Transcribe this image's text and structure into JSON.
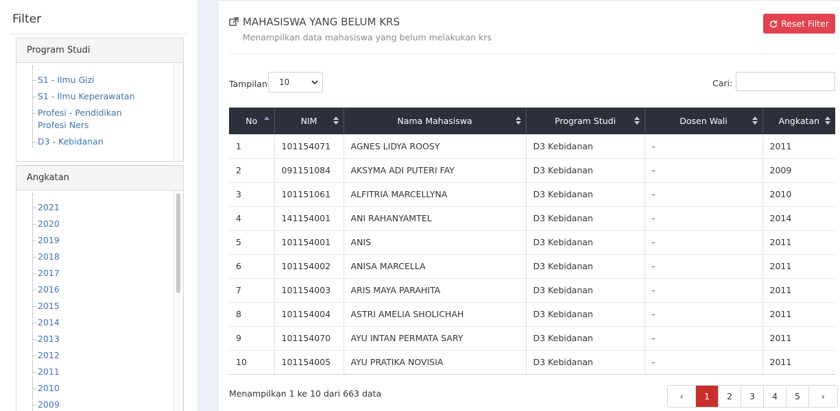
{
  "filter": {
    "title": "Filter",
    "program_studi": {
      "heading": "Program Studi",
      "items": [
        "S1 - Ilmu Gizi",
        "S1 - Ilmu Keperawatan",
        "Profesi - Pendidikan Profesi Ners",
        "D3 - Kebidanan"
      ]
    },
    "angkatan": {
      "heading": "Angkatan",
      "items": [
        "2021",
        "2020",
        "2019",
        "2018",
        "2017",
        "2016",
        "2015",
        "2014",
        "2013",
        "2012",
        "2011",
        "2010",
        "2009"
      ]
    }
  },
  "page": {
    "title": "MAHASISWA YANG BELUM KRS",
    "subtitle": "Menampilkan data mahasiswa yang belum melakukan krs",
    "reset_label": "Reset Filter",
    "accent_color": "#e3434e"
  },
  "controls": {
    "tampilan_label": "Tampilan",
    "tampilan_value": "10",
    "cari_label": "Cari:",
    "cari_value": ""
  },
  "table": {
    "headers": [
      "No",
      "NIM",
      "Nama Mahasiswa",
      "Program Studi",
      "Dosen Wali",
      "Angkatan"
    ],
    "rows": [
      [
        "1",
        "101154071",
        "AGNES LIDYA ROOSY",
        "D3 Kebidanan",
        "-",
        "2011"
      ],
      [
        "2",
        "091151084",
        "AKSYMA ADI PUTERI FAY",
        "D3 Kebidanan",
        "-",
        "2009"
      ],
      [
        "3",
        "101151061",
        "ALFITRIA MARCELLYNA",
        "D3 Kebidanan",
        "-",
        "2010"
      ],
      [
        "4",
        "141154001",
        "ANI RAHANYAMTEL",
        "D3 Kebidanan",
        "-",
        "2014"
      ],
      [
        "5",
        "101154001",
        "ANIS",
        "D3 Kebidanan",
        "-",
        "2011"
      ],
      [
        "6",
        "101154002",
        "ANISA MARCELLA",
        "D3 Kebidanan",
        "-",
        "2011"
      ],
      [
        "7",
        "101154003",
        "ARIS MAYA PARAHITA",
        "D3 Kebidanan",
        "-",
        "2011"
      ],
      [
        "8",
        "101154004",
        "ASTRI AMELIA SHOLICHAH",
        "D3 Kebidanan",
        "-",
        "2011"
      ],
      [
        "9",
        "101154070",
        "AYU INTAN PERMATA SARY",
        "D3 Kebidanan",
        "-",
        "2011"
      ],
      [
        "10",
        "101154005",
        "AYU PRATIKA NOVISIA",
        "D3 Kebidanan",
        "-",
        "2011"
      ]
    ]
  },
  "footer": {
    "info": "Menampilkan 1 ke 10 dari 663 data",
    "prev": "‹",
    "next": "›",
    "pages": [
      "1",
      "2",
      "3",
      "4",
      "5"
    ],
    "active_page": "1"
  }
}
